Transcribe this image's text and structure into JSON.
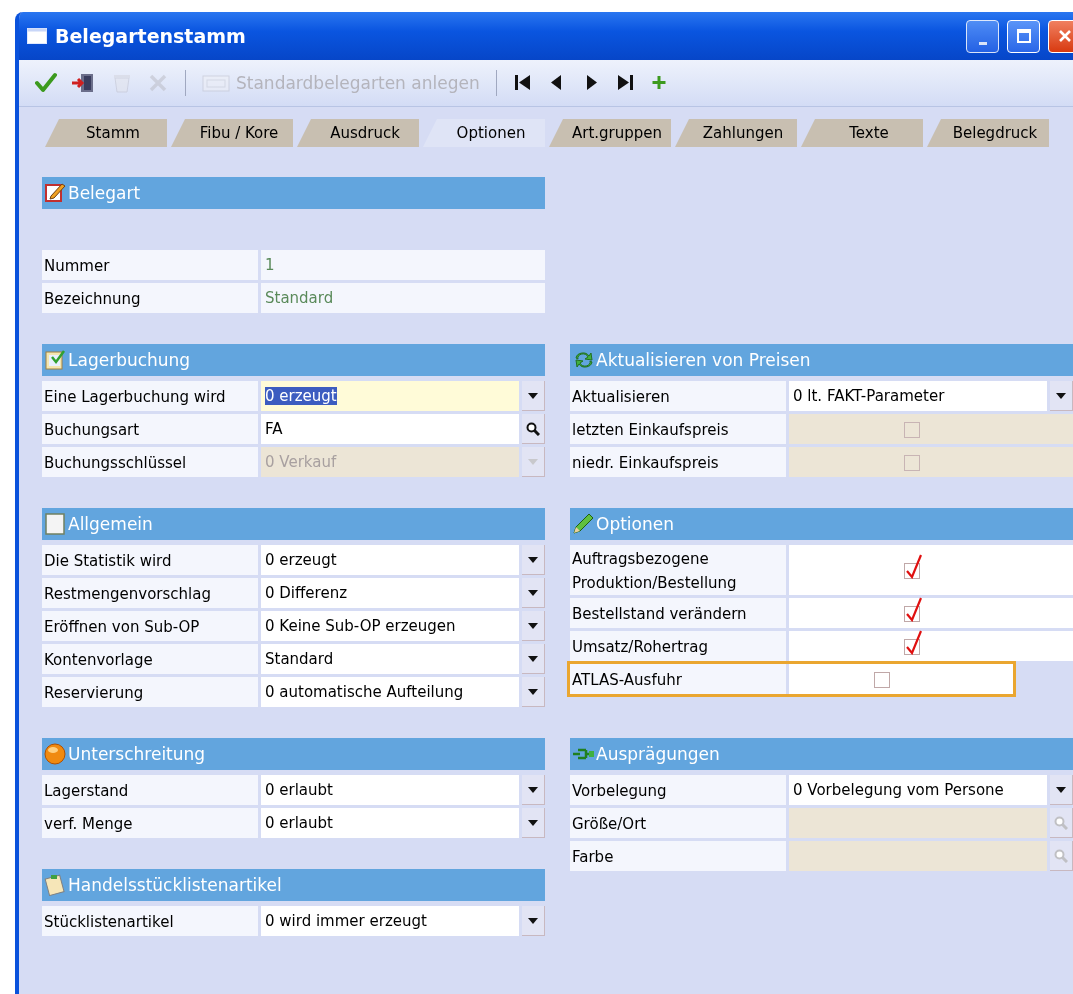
{
  "window": {
    "title": "Belegartenstamm"
  },
  "toolbar": [
    {
      "kind": "save",
      "disabled": false
    },
    {
      "kind": "exit",
      "disabled": false
    },
    {
      "kind": "recycle",
      "disabled": true
    },
    {
      "kind": "delete",
      "disabled": true
    },
    {
      "kind": "separator"
    },
    {
      "kind": "new",
      "label": "Standardbelegarten anlegen",
      "disabled": true
    },
    {
      "kind": "separator"
    },
    {
      "kind": "first",
      "disabled": false
    },
    {
      "kind": "prev",
      "disabled": false
    },
    {
      "kind": "next",
      "disabled": false
    },
    {
      "kind": "last",
      "disabled": false
    },
    {
      "kind": "add",
      "disabled": false
    }
  ],
  "tabs": [
    {
      "label": "Stamm",
      "selected": false
    },
    {
      "label": "Fibu / Kore",
      "selected": false
    },
    {
      "label": "Ausdruck",
      "selected": false
    },
    {
      "label": "Optionen",
      "selected": true
    },
    {
      "label": "Art.gruppen",
      "selected": false
    },
    {
      "label": "Zahlungen",
      "selected": false
    },
    {
      "label": "Texte",
      "selected": false
    },
    {
      "label": "Belegdruck",
      "selected": false
    }
  ],
  "panel_rows": [
    [
      [
        {
          "title": "Belegart",
          "fields": [
            {
              "label": "Nummer",
              "kind": "display",
              "value": "1",
              "disabled": false,
              "focused": false,
              "highlighted": false
            },
            {
              "label": "Bezeichnung",
              "kind": "display",
              "value": "Standard",
              "disabled": false,
              "focused": false,
              "highlighted": false
            }
          ]
        }
      ]
    ],
    [
      [
        {
          "title": "Lagerbuchung",
          "fields": [
            {
              "label": "Eine Lagerbuchung wird",
              "kind": "combo",
              "value": "0 erzeugt",
              "disabled": false,
              "focused": true,
              "highlighted": false
            },
            {
              "label": "Buchungsart",
              "kind": "lookup",
              "value": "FA",
              "disabled": false,
              "focused": false,
              "highlighted": false
            },
            {
              "label": "Buchungsschlüssel",
              "kind": "combo",
              "value": "0  Verkauf",
              "disabled": true,
              "focused": false,
              "highlighted": false
            }
          ]
        }
      ],
      [
        {
          "title": "Aktualisieren von Preisen",
          "fields": [
            {
              "label": "Aktualisieren",
              "kind": "combo",
              "value": "0 lt. FAKT-Parameter",
              "disabled": false,
              "focused": false,
              "highlighted": false
            },
            {
              "label": "letzten Einkaufspreis",
              "kind": "checkbox",
              "checked": false,
              "disabled": true,
              "focused": false,
              "highlighted": false
            },
            {
              "label": "niedr. Einkaufspreis",
              "kind": "checkbox",
              "checked": false,
              "disabled": true,
              "focused": false,
              "highlighted": false
            }
          ]
        }
      ]
    ],
    [
      [
        {
          "title": "Allgemein",
          "fields": [
            {
              "label": "Die Statistik wird",
              "kind": "combo",
              "value": "0 erzeugt",
              "disabled": false,
              "focused": false,
              "highlighted": false
            },
            {
              "label": "Restmengenvorschlag",
              "kind": "combo",
              "value": "0 Differenz",
              "disabled": false,
              "focused": false,
              "highlighted": false
            },
            {
              "label": "Eröffnen von Sub-OP",
              "kind": "combo",
              "value": "0 Keine Sub-OP erzeugen",
              "disabled": false,
              "focused": false,
              "highlighted": false
            },
            {
              "label": "Kontenvorlage",
              "kind": "combo",
              "value": "Standard",
              "disabled": false,
              "focused": false,
              "highlighted": false
            },
            {
              "label": "Reservierung",
              "kind": "combo",
              "value": "0 automatische Aufteilung",
              "disabled": false,
              "focused": false,
              "highlighted": false
            }
          ]
        }
      ],
      [
        {
          "title": "Optionen",
          "fields": [
            {
              "label": "Auftragsbezogene Produktion/Bestellung",
              "kind": "checkbox",
              "checked": true,
              "disabled": false,
              "focused": false,
              "highlighted": false
            },
            {
              "label": "Bestellstand verändern",
              "kind": "checkbox",
              "checked": true,
              "disabled": false,
              "focused": false,
              "highlighted": false
            },
            {
              "label": "Umsatz/Rohertrag",
              "kind": "checkbox",
              "checked": true,
              "disabled": false,
              "focused": false,
              "highlighted": false
            },
            {
              "label": "ATLAS-Ausfuhr",
              "kind": "checkbox",
              "checked": false,
              "disabled": false,
              "focused": false,
              "highlighted": true
            }
          ]
        }
      ]
    ],
    [
      [
        {
          "title": "Unterschreitung",
          "fields": [
            {
              "label": "Lagerstand",
              "kind": "combo",
              "value": "0 erlaubt",
              "disabled": false,
              "focused": false,
              "highlighted": false
            },
            {
              "label": "verf. Menge",
              "kind": "combo",
              "value": "0 erlaubt",
              "disabled": false,
              "focused": false,
              "highlighted": false
            }
          ]
        },
        {
          "title": "Handelsstücklistenartikel",
          "fields": [
            {
              "label": "Stücklistenartikel",
              "kind": "combo",
              "value": "0 wird immer erzeugt",
              "disabled": false,
              "focused": false,
              "highlighted": false
            }
          ]
        }
      ],
      [
        {
          "title": "Ausprägungen",
          "fields": [
            {
              "label": "Vorbelegung",
              "kind": "combo",
              "value": "0 Vorbelegung vom Persone",
              "disabled": false,
              "focused": false,
              "highlighted": false
            },
            {
              "label": "Größe/Ort",
              "kind": "lookup",
              "disabled": true,
              "focused": false,
              "highlighted": false
            },
            {
              "label": "Farbe",
              "kind": "lookup",
              "disabled": true,
              "focused": false,
              "highlighted": false
            }
          ]
        }
      ]
    ]
  ]
}
